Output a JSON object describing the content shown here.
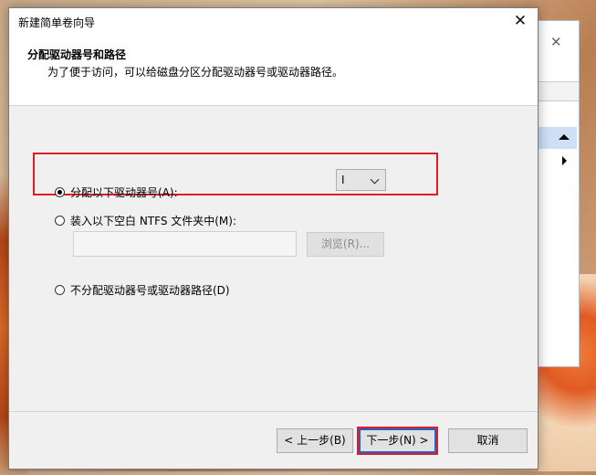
{
  "window": {
    "title": "新建简单卷向导",
    "close_glyph": "✕"
  },
  "header": {
    "title": "分配驱动器号和路径",
    "subtitle": "为了便于访问，可以给磁盘分区分配驱动器号或驱动器路径。"
  },
  "options": {
    "assign_letter_label": "分配以下驱动器号(A):",
    "assign_letter_selected": true,
    "drive_letter_value": "I",
    "mount_folder_label": "装入以下空白 NTFS 文件夹中(M):",
    "mount_folder_selected": false,
    "folder_path_value": "",
    "browse_label": "浏览(R)...",
    "no_letter_label": "不分配驱动器号或驱动器路径(D)",
    "no_letter_selected": false
  },
  "buttons": {
    "prev": "< 上一步(B)",
    "next": "下一步(N) >",
    "cancel": "取消"
  },
  "background_window": {
    "close_glyph": "✕"
  },
  "colors": {
    "highlight": "#e01b24",
    "focus": "#1e63d0",
    "selection": "#cde0f4"
  }
}
